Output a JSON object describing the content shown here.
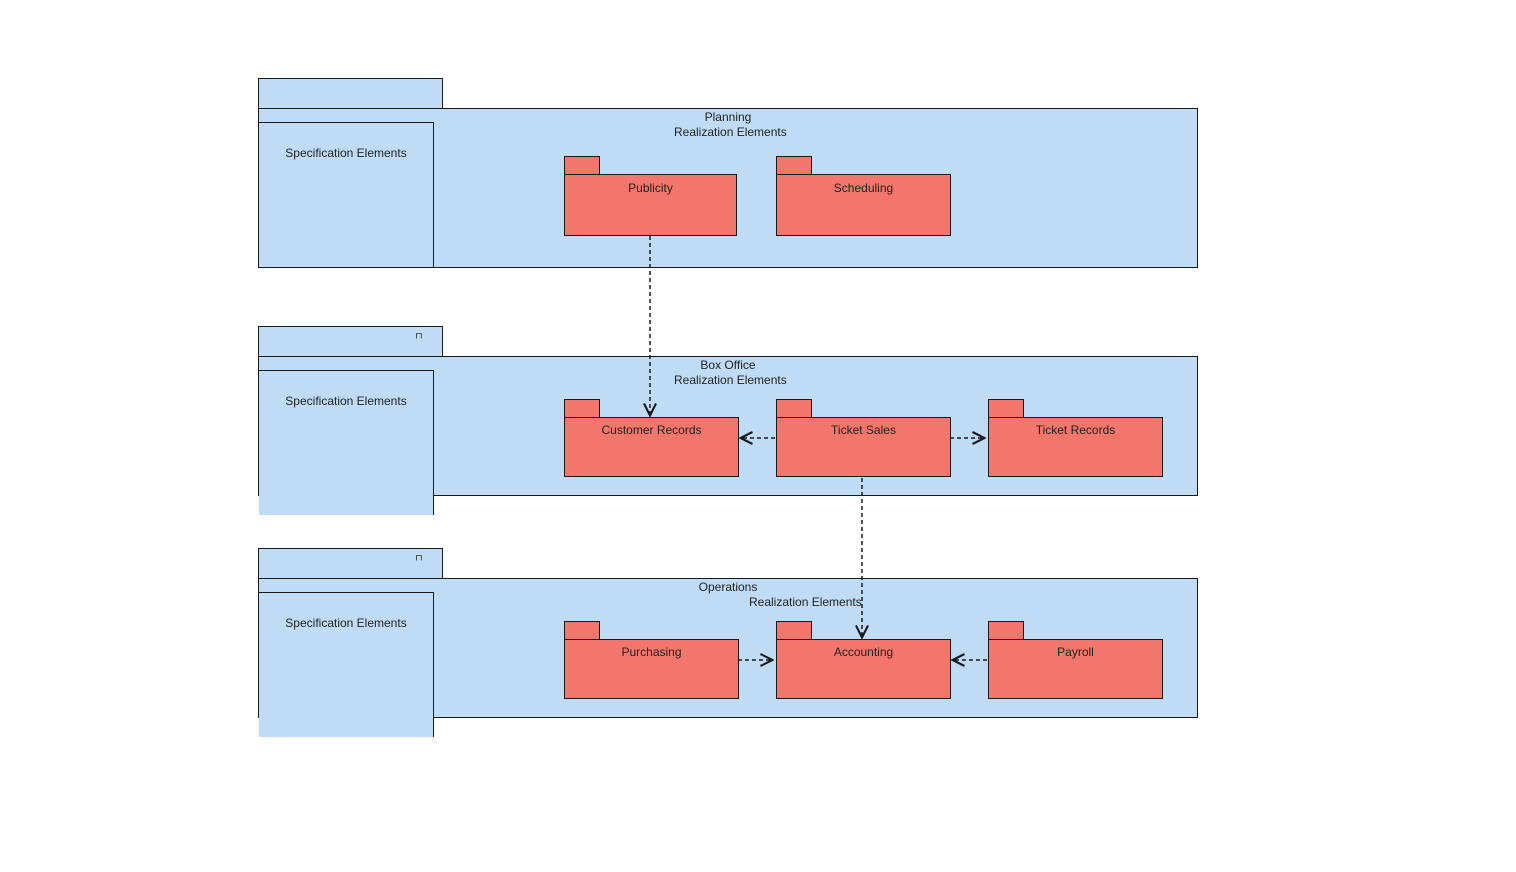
{
  "colors": {
    "container_fill": "#bfdcf4",
    "package_fill": "#f2766c",
    "stroke": "#1a1a1a"
  },
  "containers": [
    {
      "id": "planning",
      "title": "Planning",
      "realization_label": "Realization Elements",
      "spec_label": "Specification Elements",
      "packages": [
        {
          "id": "publicity",
          "label": "Publicity"
        },
        {
          "id": "scheduling",
          "label": "Scheduling"
        }
      ]
    },
    {
      "id": "box_office",
      "title": "Box Office",
      "realization_label": "Realization Elements",
      "spec_label": "Specification Elements",
      "stereotype_icon": "⊓",
      "packages": [
        {
          "id": "customer_records",
          "label": "Customer Records"
        },
        {
          "id": "ticket_sales",
          "label": "Ticket Sales"
        },
        {
          "id": "ticket_records",
          "label": "Ticket Records"
        }
      ]
    },
    {
      "id": "operations",
      "title": "Operations",
      "realization_label": "Realization Elements",
      "spec_label": "Specification Elements",
      "stereotype_icon": "⊓",
      "packages": [
        {
          "id": "purchasing",
          "label": "Purchasing"
        },
        {
          "id": "accounting",
          "label": "Accounting"
        },
        {
          "id": "payroll",
          "label": "Payroll"
        }
      ]
    }
  ],
  "connections": [
    {
      "from": "publicity",
      "to": "customer_records",
      "direction": "down"
    },
    {
      "from": "ticket_sales",
      "to": "customer_records",
      "direction": "left"
    },
    {
      "from": "ticket_sales",
      "to": "ticket_records",
      "direction": "right"
    },
    {
      "from": "ticket_sales",
      "to": "accounting",
      "direction": "down"
    },
    {
      "from": "purchasing",
      "to": "accounting",
      "direction": "right"
    },
    {
      "from": "payroll",
      "to": "accounting",
      "direction": "left"
    }
  ]
}
